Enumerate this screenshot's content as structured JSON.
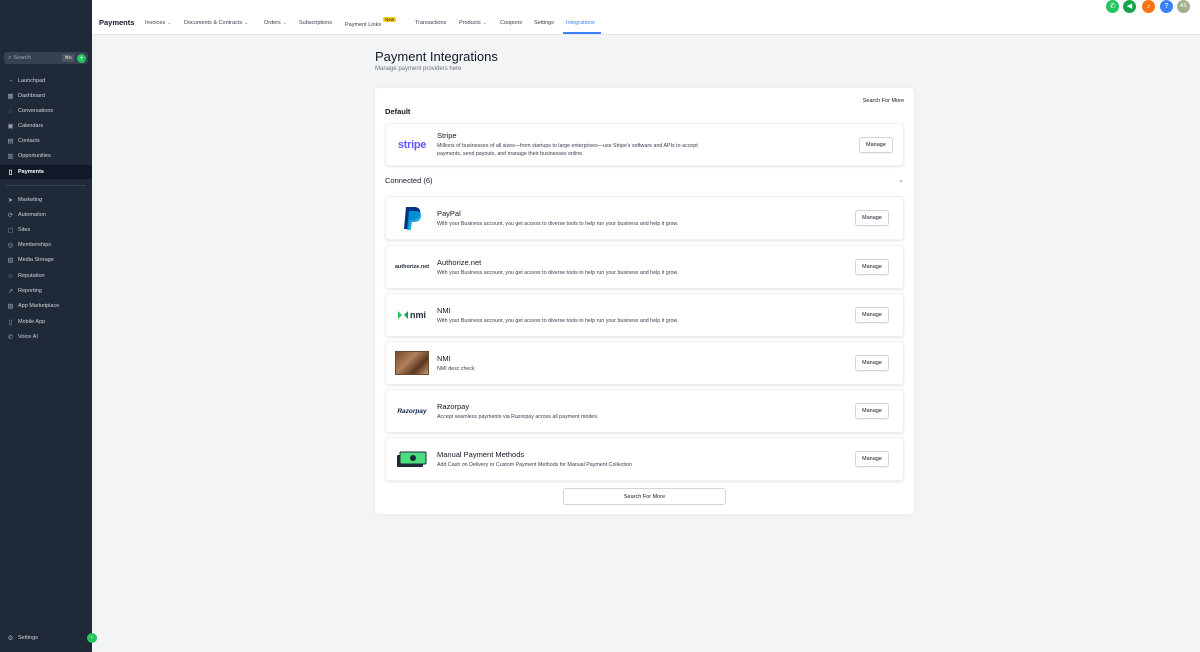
{
  "sidebar": {
    "search_placeholder": "Search",
    "search_shortcut": "⌘K",
    "items": [
      {
        "label": "Launchpad",
        "icon": "rocket-icon"
      },
      {
        "label": "Dashboard",
        "icon": "grid-icon"
      },
      {
        "label": "Conversations",
        "icon": "chat-icon"
      },
      {
        "label": "Calendars",
        "icon": "calendar-icon"
      },
      {
        "label": "Contacts",
        "icon": "contacts-icon"
      },
      {
        "label": "Opportunities",
        "icon": "funnel-icon"
      },
      {
        "label": "Payments",
        "icon": "receipt-icon"
      },
      {
        "label": "Marketing",
        "icon": "send-icon"
      },
      {
        "label": "Automation",
        "icon": "automation-icon"
      },
      {
        "label": "Sites",
        "icon": "sites-icon"
      },
      {
        "label": "Memberships",
        "icon": "membership-icon"
      },
      {
        "label": "Media Storage",
        "icon": "media-icon"
      },
      {
        "label": "Reputation",
        "icon": "star-icon"
      },
      {
        "label": "Reporting",
        "icon": "chart-icon"
      },
      {
        "label": "App Marketplace",
        "icon": "marketplace-icon"
      },
      {
        "label": "Mobile App",
        "icon": "mobile-icon"
      },
      {
        "label": "Voice AI",
        "icon": "phone-icon"
      }
    ],
    "settings_label": "Settings"
  },
  "topnav": {
    "brand": "Payments",
    "tabs": [
      {
        "label": "Invoices"
      },
      {
        "label": "Documents & Contracts"
      },
      {
        "label": "Orders"
      },
      {
        "label": "Subscriptions"
      },
      {
        "label": "Payment Links"
      },
      {
        "label": "Transactions"
      },
      {
        "label": "Products"
      },
      {
        "label": "Coupons"
      },
      {
        "label": "Settings"
      },
      {
        "label": "Integrations"
      }
    ],
    "new_badge": "New",
    "active_tab": "Integrations",
    "avatar_initials": "AS"
  },
  "page": {
    "title": "Payment Integrations",
    "subtitle": "Manage payment providers here"
  },
  "panel": {
    "search_more_top": "Search For More",
    "default_heading": "Default",
    "connected_heading": "Connected (6)",
    "search_more_button": "Search For More",
    "manage_label": "Manage",
    "default_provider": {
      "name": "Stripe",
      "logo_text": "stripe",
      "desc_line1": "Millions of businesses of all sizes—from startups to large enterprises—use Stripe's software and APIs to accept",
      "desc_line2": "payments, send payouts, and manage their businesses online."
    },
    "connected": [
      {
        "name": "PayPal",
        "desc": "With your Business account, you get access to diverse tools to help run your business and help it grow."
      },
      {
        "name": "Authorize.net",
        "logo_text": "authorize.net",
        "desc": "With your Business account, you get access to diverse tools to help run your business and help it grow."
      },
      {
        "name": "NMI",
        "logo_text": "nmi",
        "desc": "With your Business account, you get access to diverse tools to help run your business and help it grow."
      },
      {
        "name": "NMI",
        "desc": "NMI desc check"
      },
      {
        "name": "Razorpay",
        "logo_text": "Razorpay",
        "desc": "Accept seamless payments via Razorpay across all payment modes."
      },
      {
        "name": "Manual Payment Methods",
        "desc": "Add Cash on Delivery or Custom Payment Methods for Manual Payment Collection"
      }
    ]
  },
  "colors": {
    "sidebar_bg": "#1f2937",
    "accent": "#3b82f6",
    "stripe": "#635bff",
    "paypal_dark": "#003087",
    "paypal_light": "#009cde",
    "nmi_green": "#22c55e",
    "badge_yellow": "#facc15"
  }
}
